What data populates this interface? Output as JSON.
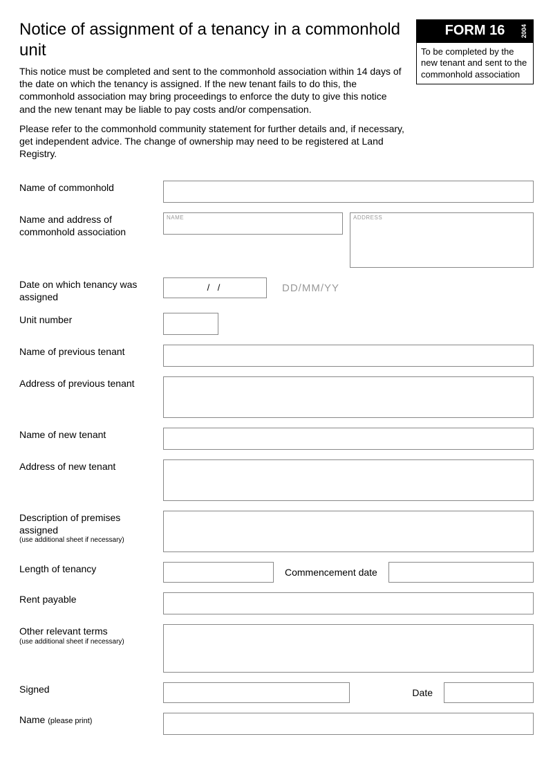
{
  "header": {
    "title": "Notice of assignment of a tenancy in a commonhold unit",
    "form_number": "FORM 16",
    "year": "2004",
    "instruction": "To be completed by the new tenant and sent to the commonhold association",
    "para1": "This notice must be completed and sent to the commonhold association within 14 days of the date on which the tenancy is assigned. If the new tenant fails to do this, the commonhold association may bring proceedings to enforce the duty to give this notice and the new tenant may be liable to pay costs and/or compensation.",
    "para2": "Please refer to the commonhold community statement for further details and, if necessary, get independent advice. The change of ownership may need to be registered at Land Registry."
  },
  "labels": {
    "commonhold_name": "Name of commonhold",
    "assoc": "Name and address of commonhold association",
    "assoc_name_inner": "NAME",
    "assoc_addr_inner": "ADDRESS",
    "date_assigned": "Date on which tenancy was assigned",
    "date_template": "/        /",
    "date_hint": "DD/MM/YY",
    "unit_number": "Unit number",
    "prev_tenant_name": "Name of previous tenant",
    "prev_tenant_addr": "Address of previous tenant",
    "new_tenant_name": "Name of new tenant",
    "new_tenant_addr": "Address of new tenant",
    "premises": "Description of premises assigned",
    "premises_hint": "(use additional sheet if necessary)",
    "length": "Length of tenancy",
    "commencement": "Commencement date",
    "rent": "Rent payable",
    "other_terms": "Other relevant terms",
    "other_terms_hint": "(use additional sheet if necessary)",
    "signed": "Signed",
    "date": "Date",
    "name_print": "Name ",
    "name_print_hint": "(please print)"
  }
}
